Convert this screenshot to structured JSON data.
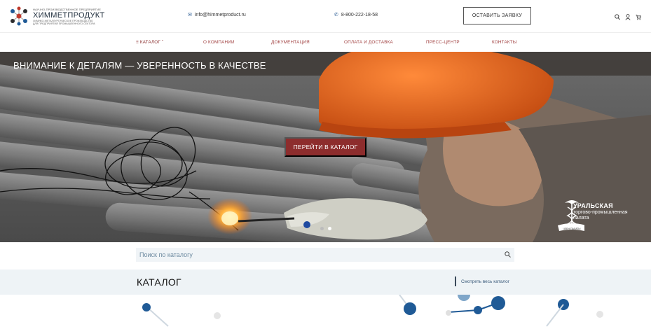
{
  "header": {
    "logo": {
      "tagline": "НАУЧНО-ПРОИЗВОДСТВЕННОЕ ПРЕДПРИЯТИЕ",
      "name": "ХИММЕТПРОДУКТ",
      "subtitle1": "ХИМИКО-МЕТАЛЛУРГИЧЕСКОЕ ПРОИЗВОДСТВО",
      "subtitle2": "ДЛЯ ПРЕДПРИЯТИЙ ПРОМЫШЛЕННОГО СЕКТОРА"
    },
    "email": "info@himmetproduct.ru",
    "phone": "8-800-222-18-58",
    "apply_label": "ОСТАВИТЬ ЗАЯВКУ",
    "icons": [
      "search-icon",
      "user-icon",
      "cart-icon"
    ]
  },
  "nav": {
    "items": [
      {
        "label": "КАТАЛОГ"
      },
      {
        "label": "О КОМПАНИИ"
      },
      {
        "label": "ДОКУМЕНТАЦИЯ"
      },
      {
        "label": "ОПЛАТА И ДОСТАВКА"
      },
      {
        "label": "ПРЕСС-ЦЕНТР"
      },
      {
        "label": "КОНТАКТЫ"
      }
    ]
  },
  "hero": {
    "title": "ВНИМАНИЕ К ДЕТАЛЯМ — УВЕРЕННОСТЬ В КАЧЕСТВЕ",
    "button_label": "ПЕРЕЙТИ В КАТАЛОГ",
    "slides_count": 2,
    "active_slide": 2,
    "badge": {
      "line1": "УРАЛЬСКАЯ",
      "line2": "торгово-промышленная",
      "line3": "палата",
      "ribbon": "ЧЛЕН ПАЛАТЫ"
    }
  },
  "search": {
    "placeholder": "Поиск по каталогу",
    "value": ""
  },
  "catalog": {
    "title": "КАТАЛОГ",
    "link_label": "Смотреть весь каталог"
  },
  "colors": {
    "accent": "#8d2d2d",
    "nav_text": "#a04040",
    "link_blue": "#2c5d94",
    "hex_blue": "#1f5a96",
    "helmet_orange": "#e8601a"
  }
}
